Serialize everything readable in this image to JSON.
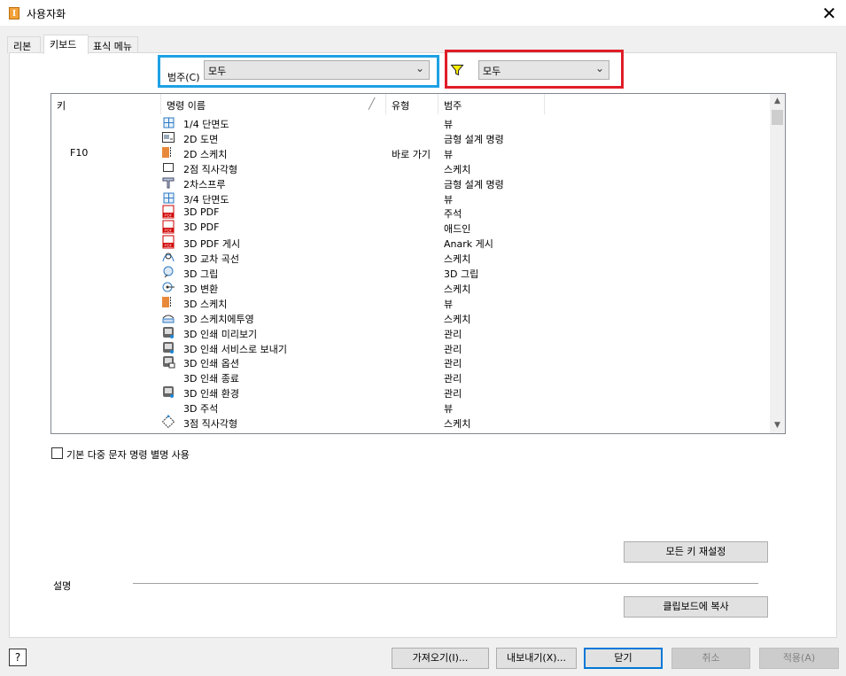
{
  "window": {
    "title": "사용자화",
    "close_glyph": "✕"
  },
  "tabs": [
    {
      "label": "리본",
      "active": false
    },
    {
      "label": "키보드",
      "active": true
    },
    {
      "label": "표식 메뉴",
      "active": false
    }
  ],
  "category_filter": {
    "label": "범주(C)",
    "value": "모두"
  },
  "type_filter": {
    "icon": "filter-icon",
    "value": "모두"
  },
  "highlight_colors": {
    "blue": "#1da1e4",
    "red": "#e01d27"
  },
  "table": {
    "headers": {
      "key": "키",
      "command": "명령 이름",
      "type": "유형",
      "category": "범주"
    },
    "rows": [
      {
        "key": "",
        "icon": "section-view-icon",
        "command": "1/4 단면도",
        "type": "",
        "category": "뷰"
      },
      {
        "key": "",
        "icon": "drawing-icon",
        "command": "2D 도면",
        "type": "",
        "category": "금형 설계 명령"
      },
      {
        "key": "F10",
        "icon": "sketch-icon",
        "command": "2D 스케치",
        "type": "바로 가기",
        "category": "뷰"
      },
      {
        "key": "",
        "icon": "rectangle-icon",
        "command": "2점 직사각형",
        "type": "",
        "category": "스케치"
      },
      {
        "key": "",
        "icon": "sprue-icon",
        "command": "2차스프루",
        "type": "",
        "category": "금형 설계 명령"
      },
      {
        "key": "",
        "icon": "section-view-icon",
        "command": "3/4 단면도",
        "type": "",
        "category": "뷰"
      },
      {
        "key": "",
        "icon": "pdf-icon",
        "command": "3D PDF",
        "type": "",
        "category": "주석"
      },
      {
        "key": "",
        "icon": "pdf-icon",
        "command": "3D PDF",
        "type": "",
        "category": "애드인"
      },
      {
        "key": "",
        "icon": "pdf-icon",
        "command": "3D PDF 게시",
        "type": "",
        "category": "Anark 게시"
      },
      {
        "key": "",
        "icon": "intersection-curve-icon",
        "command": "3D 교차 곡선",
        "type": "",
        "category": "스케치"
      },
      {
        "key": "",
        "icon": "grip-icon",
        "command": "3D 그립",
        "type": "",
        "category": "3D 그립"
      },
      {
        "key": "",
        "icon": "transform-icon",
        "command": "3D 변환",
        "type": "",
        "category": "스케치"
      },
      {
        "key": "",
        "icon": "sketch-icon",
        "command": "3D 스케치",
        "type": "",
        "category": "뷰"
      },
      {
        "key": "",
        "icon": "project-icon",
        "command": "3D 스케치에투영",
        "type": "",
        "category": "스케치"
      },
      {
        "key": "",
        "icon": "print-icon",
        "command": "3D 인쇄 미리보기",
        "type": "",
        "category": "관리"
      },
      {
        "key": "",
        "icon": "print-icon",
        "command": "3D 인쇄 서비스로 보내기",
        "type": "",
        "category": "관리"
      },
      {
        "key": "",
        "icon": "print-options-icon",
        "command": "3D 인쇄 옵션",
        "type": "",
        "category": "관리"
      },
      {
        "key": "",
        "icon": "",
        "command": "3D 인쇄 종료",
        "type": "",
        "category": "관리"
      },
      {
        "key": "",
        "icon": "print-icon",
        "command": "3D 인쇄 환경",
        "type": "",
        "category": "관리"
      },
      {
        "key": "",
        "icon": "",
        "command": "3D 주석",
        "type": "",
        "category": "뷰"
      },
      {
        "key": "",
        "icon": "three-point-rectangle-icon",
        "command": "3점 직사각형",
        "type": "",
        "category": "스케치"
      }
    ]
  },
  "options": {
    "multi_char_alias_label": "기본 다중 문자 명령 별명 사용",
    "multi_char_alias_checked": false
  },
  "buttons": {
    "reset_all_keys": "모든 키 재설정",
    "copy_to_clipboard": "클립보드에 복사",
    "import": "가져오기(I)...",
    "export": "내보내기(X)...",
    "close": "닫기",
    "cancel": "취소",
    "apply": "적용(A)"
  },
  "description": {
    "label": "설명",
    "text": ""
  },
  "help": {
    "glyph": "?"
  }
}
